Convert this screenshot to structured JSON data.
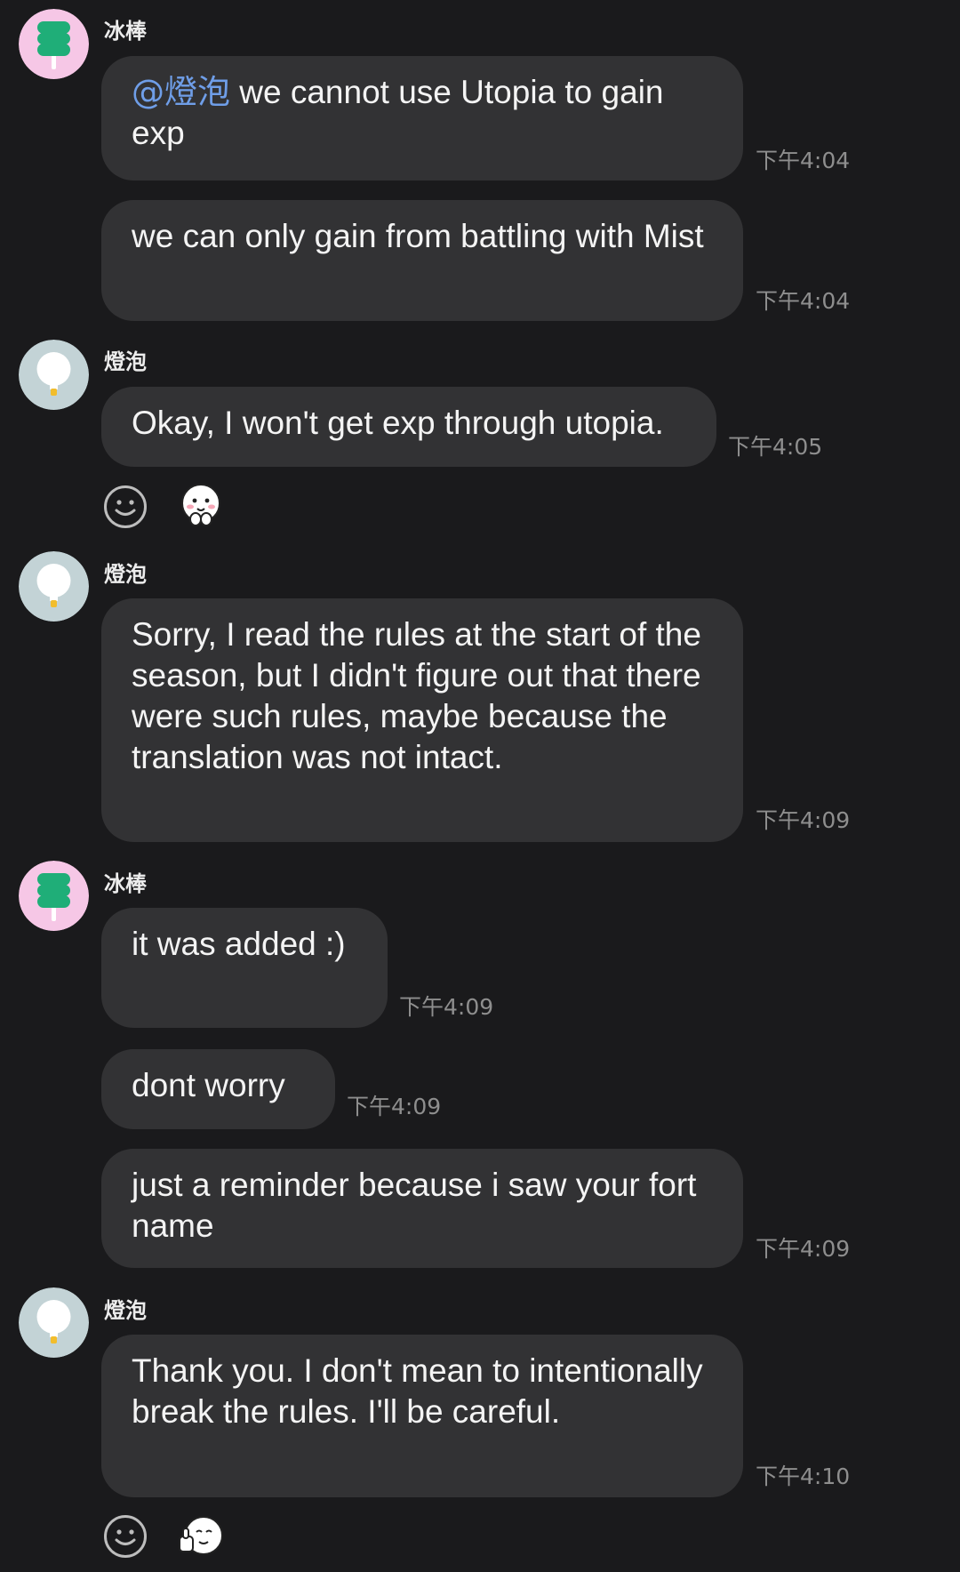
{
  "conversation": {
    "senders": {
      "bingbang": "冰棒",
      "dengpao": "燈泡"
    },
    "messages": [
      {
        "mention": "@燈泡",
        "text": " we cannot use Utopia to gain exp",
        "time": "下午4:04"
      },
      {
        "text": "we can only gain from battling with Mist",
        "time": "下午4:04"
      },
      {
        "text": "Okay, I won't get exp through utopia.",
        "time": "下午4:05"
      },
      {
        "text": "Sorry, I read the rules at the start of the season, but I didn't figure out that there were such rules, maybe because the translation was not intact.",
        "time": "下午4:09"
      },
      {
        "text": "it was added :)",
        "time": "下午4:09"
      },
      {
        "text": "dont worry",
        "time": "下午4:09"
      },
      {
        "text": "just a reminder because i saw your fort name",
        "time": "下午4:09"
      },
      {
        "text": "Thank you. I don't mean to intentionally break the rules. I'll be careful.",
        "time": "下午4:10"
      }
    ]
  },
  "icons": {
    "avatar_bingbang": "popsicle-avatar-icon",
    "avatar_dengpao": "lightbulb-avatar-icon",
    "add_reaction": "smiley-outline-icon",
    "sticker_shy": "shy-face-sticker-icon",
    "sticker_thumbsup": "thumbs-up-face-sticker-icon"
  },
  "colors": {
    "background": "#1a1a1c",
    "bubble": "#323234",
    "mention": "#6f9ee8",
    "timestamp": "#8e8e8e",
    "avatar_pink": "#f6c7e6",
    "popsicle_green": "#1fae78",
    "avatar_gray": "#c3d3d6"
  }
}
